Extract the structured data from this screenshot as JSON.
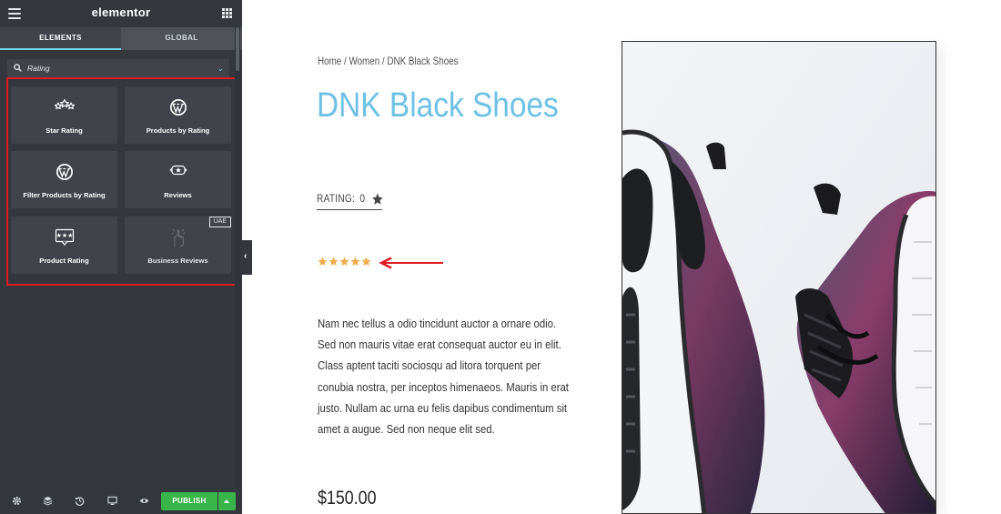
{
  "panel": {
    "brand": "elementor",
    "tabs": [
      {
        "label": "ELEMENTS",
        "active": true
      },
      {
        "label": "GLOBAL",
        "active": false
      }
    ],
    "search": {
      "value": "Rating",
      "icon": "search-icon"
    },
    "widgets": [
      {
        "label": "Star Rating",
        "icon": "star-rating-icon"
      },
      {
        "label": "Products by Rating",
        "icon": "wordpress-icon"
      },
      {
        "label": "Filter Products by Rating",
        "icon": "wordpress-icon"
      },
      {
        "label": "Reviews",
        "icon": "reviews-icon"
      },
      {
        "label": "Product Rating",
        "icon": "product-rating-icon"
      },
      {
        "label": "Business Reviews",
        "icon": "business-reviews-icon",
        "badge": "UAE"
      }
    ],
    "footer": {
      "icons": [
        "settings-icon",
        "layers-icon",
        "history-icon",
        "responsive-icon",
        "preview-icon"
      ],
      "publish_label": "PUBLISH"
    },
    "accent": "#71d7f7",
    "highlight_color": "#e01a22"
  },
  "page": {
    "breadcrumb": "Home / Women / DNK Black Shoes",
    "title": "DNK Black Shoes",
    "title_color": "#6ec1e4",
    "rating_label": "RATING:",
    "rating_value": "0",
    "star_rating": 5,
    "star_color": "#f0ad4e",
    "description": "Nam nec tellus a odio tincidunt auctor a ornare odio. Sed non mauris vitae erat consequat auctor eu in elit. Class aptent taciti sociosqu ad litora torquent per conubia nostra, per inceptos himenaeos. Mauris in erat justo. Nullam ac urna eu felis dapibus condimentum sit amet a augue. Sed non neque elit sed.",
    "price": "$150.00",
    "product_image": "sneakers-image"
  }
}
